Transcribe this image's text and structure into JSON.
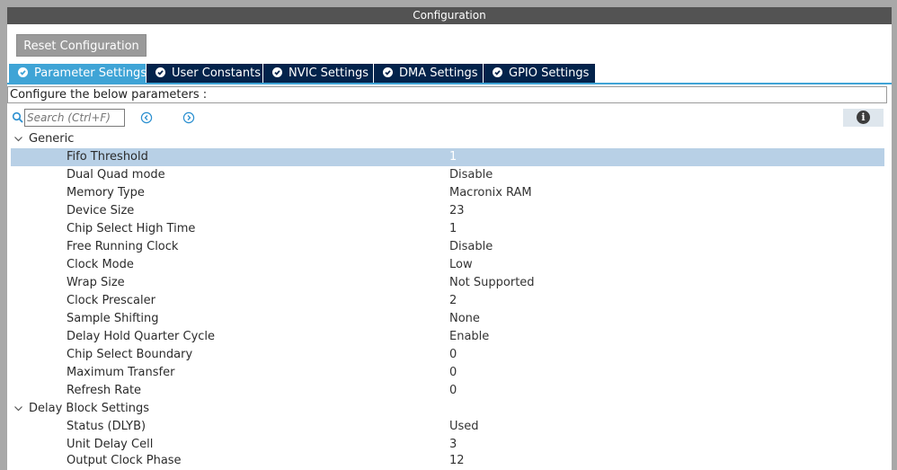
{
  "window": {
    "title": "Configuration"
  },
  "toolbar": {
    "reset_label": "Reset Configuration"
  },
  "tabs": [
    {
      "label": "Parameter Settings",
      "active": true
    },
    {
      "label": "User Constants",
      "active": false
    },
    {
      "label": "NVIC Settings",
      "active": false
    },
    {
      "label": "DMA Settings",
      "active": false
    },
    {
      "label": "GPIO Settings",
      "active": false
    }
  ],
  "configure_text": "Configure the below parameters :",
  "search": {
    "placeholder": "Search (Ctrl+F)"
  },
  "groups": {
    "generic": {
      "label": "Generic",
      "rows": [
        {
          "name": "Fifo Threshold",
          "value": "1"
        },
        {
          "name": "Dual Quad mode",
          "value": "Disable"
        },
        {
          "name": "Memory Type",
          "value": "Macronix RAM"
        },
        {
          "name": "Device Size",
          "value": "23"
        },
        {
          "name": "Chip Select High Time",
          "value": "1"
        },
        {
          "name": "Free Running Clock",
          "value": "Disable"
        },
        {
          "name": "Clock Mode",
          "value": "Low"
        },
        {
          "name": "Wrap Size",
          "value": "Not Supported"
        },
        {
          "name": "Clock Prescaler",
          "value": "2"
        },
        {
          "name": "Sample Shifting",
          "value": "None"
        },
        {
          "name": "Delay Hold Quarter Cycle",
          "value": "Enable"
        },
        {
          "name": "Chip Select Boundary",
          "value": "0"
        },
        {
          "name": "Maximum Transfer",
          "value": "0"
        },
        {
          "name": "Refresh Rate",
          "value": "0"
        }
      ]
    },
    "delay_block": {
      "label": "Delay Block Settings",
      "rows": [
        {
          "name": "Status (DLYB)",
          "value": "Used"
        },
        {
          "name": "Unit Delay Cell",
          "value": "3"
        },
        {
          "name": "Output Clock Phase",
          "value": "12"
        }
      ]
    }
  },
  "colors": {
    "tab_active": "#3fa4d6",
    "tab_inactive": "#03234b",
    "selected_row": "#b8d0e6",
    "title_bar": "#535353"
  }
}
